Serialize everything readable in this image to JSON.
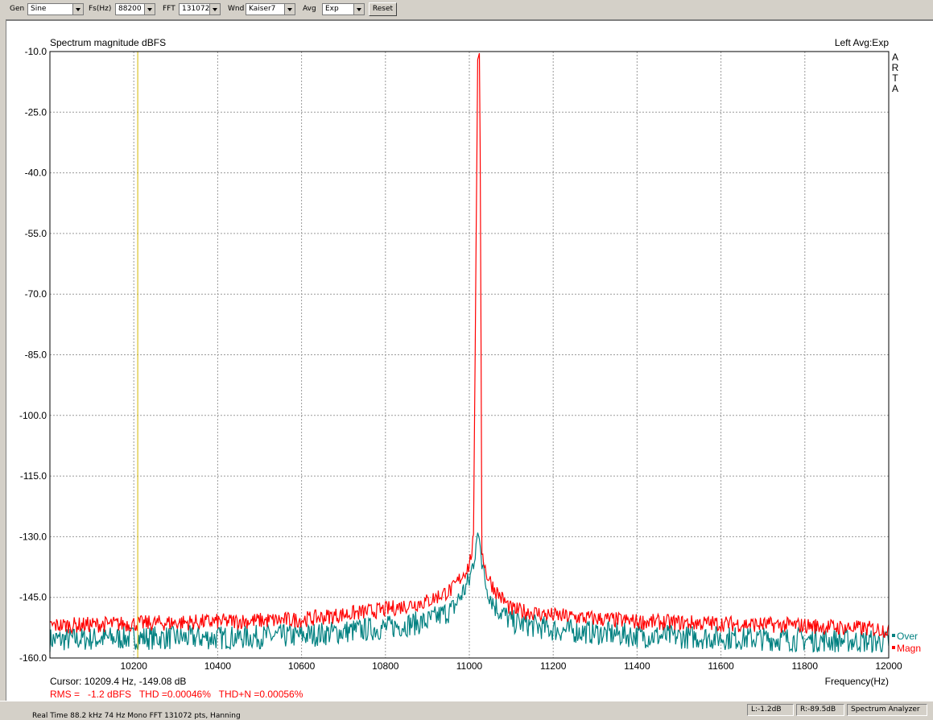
{
  "toolbar": {
    "gen_label": "Gen",
    "gen_value": "Sine",
    "fs_label": "Fs(Hz)",
    "fs_value": "88200",
    "fft_label": "FFT",
    "fft_value": "131072",
    "wnd_label": "Wnd",
    "wnd_value": "Kaiser7",
    "avg_label": "Avg",
    "avg_value": "Exp",
    "reset_label": "Reset"
  },
  "plot": {
    "title": "Spectrum magnitude dBFS",
    "channel_info": "Left  Avg:Exp",
    "logo_letters": [
      "A",
      "R",
      "T",
      "A"
    ],
    "xlabel": "Frequency(Hz)",
    "cursor_readout": "Cursor: 10209.4 Hz, -149.08 dB",
    "cursor_hz": 10209.4,
    "measurements": "RMS =   -1.2 dBFS   THD =0.00046%   THD+N =0.00056%",
    "legend": [
      {
        "name": "Over",
        "color": "#008080"
      },
      {
        "name": "Magn",
        "color": "#ff0000"
      }
    ]
  },
  "chart_data": {
    "type": "line",
    "xlim": [
      10000,
      12000
    ],
    "ylim": [
      -160,
      -10
    ],
    "x_ticks": [
      "10200",
      "10400",
      "10600",
      "10800",
      "11000",
      "11200",
      "11400",
      "11600",
      "11800",
      "12000"
    ],
    "y_ticks": [
      "-10.0",
      "-25.0",
      "-40.0",
      "-55.0",
      "-70.0",
      "-85.0",
      "-100.0",
      "-115.0",
      "-130.0",
      "-145.0",
      "-160.0"
    ],
    "grid": true,
    "series": [
      {
        "name": "Magn",
        "color": "#ff0000",
        "x": [
          10000,
          10200,
          10400,
          10600,
          10800,
          10900,
          10960,
          11000,
          11010,
          11020,
          11025,
          11030,
          11040,
          11060,
          11100,
          11200,
          11400,
          11600,
          11800,
          12000
        ],
        "y": [
          -152,
          -151.5,
          -151,
          -150.5,
          -148,
          -146,
          -143,
          -137,
          -131,
          -12,
          -10,
          -133,
          -139,
          -143,
          -148,
          -149.5,
          -151,
          -151.5,
          -152,
          -153
        ]
      },
      {
        "name": "Over",
        "color": "#008080",
        "x": [
          10000,
          10200,
          10400,
          10600,
          10800,
          10900,
          10960,
          11000,
          11010,
          11020,
          11025,
          11030,
          11040,
          11060,
          11100,
          11200,
          11400,
          11600,
          11800,
          12000
        ],
        "y": [
          -155.5,
          -155,
          -155,
          -154.5,
          -152.5,
          -151,
          -148,
          -141,
          -136,
          -129,
          -131,
          -137,
          -142,
          -147,
          -151,
          -153,
          -154.5,
          -155,
          -155.5,
          -156
        ]
      }
    ]
  },
  "statusbar": {
    "ghost_text": "Real Time       88.2 kHz    74 Hz    Mono    FFT 131072 pts, Hanning",
    "left_level": "L:-1.2dB",
    "right_level": "R:-89.5dB",
    "mode": "Spectrum Analyzer"
  }
}
